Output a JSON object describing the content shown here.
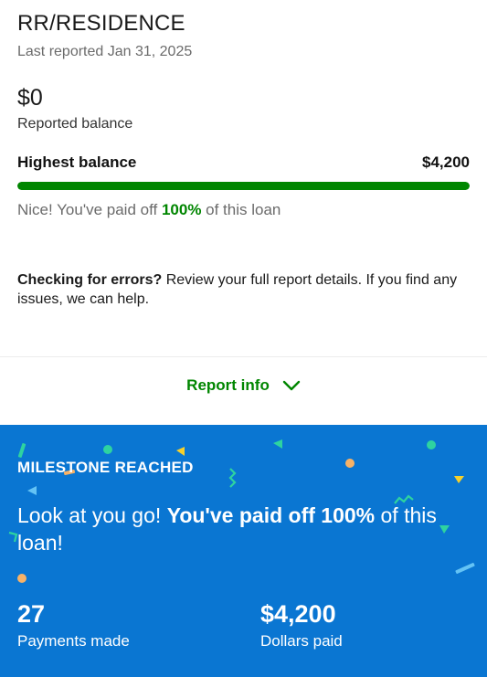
{
  "loan": {
    "title": "RR/RESIDENCE",
    "last_reported": "Last reported Jan 31, 2025",
    "balance": "$0",
    "balance_label": "Reported balance",
    "highest_label": "Highest balance",
    "highest_value": "$4,200",
    "paid_fraction": 1.0,
    "paid_prefix": "Nice! You've paid off ",
    "paid_pct": "100%",
    "paid_suffix": " of this loan"
  },
  "errors_note": {
    "bold": "Checking for errors?",
    "text": " Review your full report details. If you find any issues, we can help."
  },
  "report_info": {
    "label": "Report info",
    "icon": "chevron-down-icon"
  },
  "milestone": {
    "label": "MILESTONE REACHED",
    "text_prefix": "Look at you go! ",
    "text_bold": "You've paid off 100%",
    "text_suffix": " of this loan!",
    "stats": [
      {
        "value": "27",
        "label": "Payments made"
      },
      {
        "value": "$4,200",
        "label": "Dollars paid"
      }
    ]
  },
  "colors": {
    "accent_green": "#008600",
    "milestone_blue": "#0a76d2",
    "confetti": [
      "#2ed3a0",
      "#f7b267",
      "#f5d02c",
      "#64c3f5"
    ]
  }
}
